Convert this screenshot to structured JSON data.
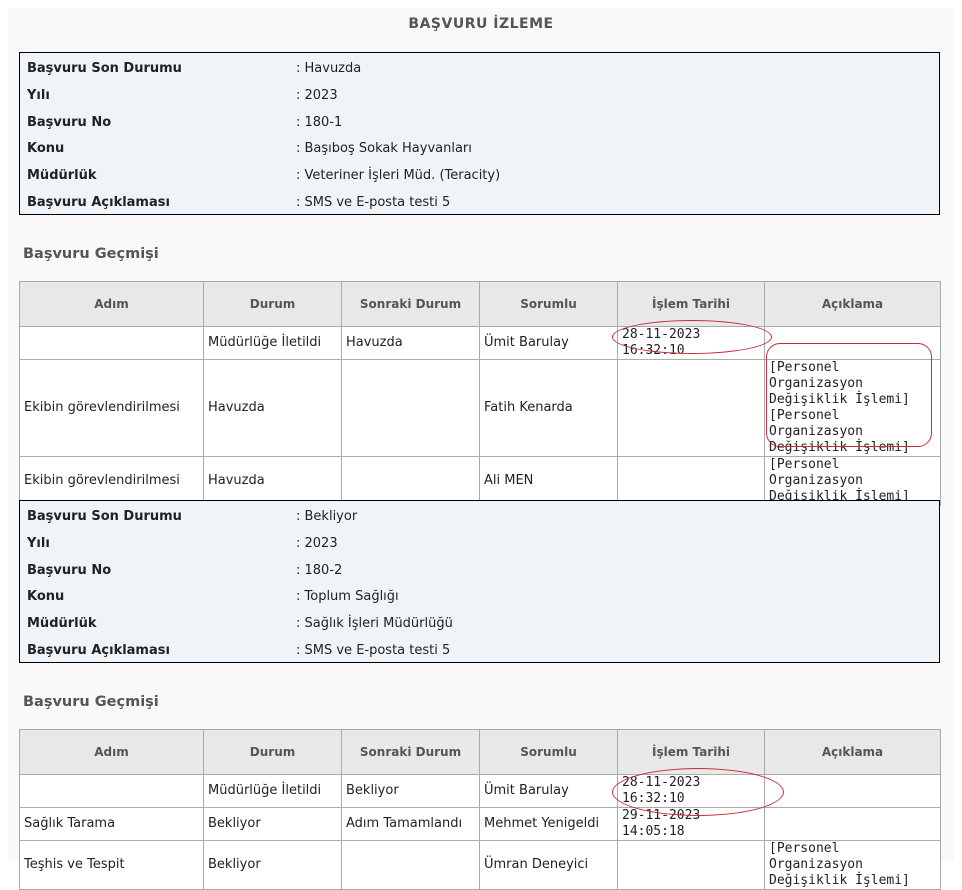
{
  "page_title": "BAŞVURU İZLEME",
  "history_heading": "Başvuru Geçmişi",
  "field_labels": {
    "status": "Başvuru Son Durumu",
    "year": "Yılı",
    "number": "Başvuru No",
    "subject": "Konu",
    "directorate": "Müdürlük",
    "description": "Başvuru Açıklaması"
  },
  "table_headers": [
    "Adım",
    "Durum",
    "Sonraki Durum",
    "Sorumlu",
    "İşlem Tarihi",
    "Açıklama"
  ],
  "applications": [
    {
      "status": ": Havuzda",
      "year": ": 2023",
      "number": ": 180-1",
      "subject": ": Başıboş Sokak Hayvanları",
      "directorate": ": Veteriner İşleri Müd. (Teracity)",
      "description": ": SMS ve E-posta testi 5",
      "rows": [
        {
          "step": "",
          "state": "Müdürlüğe İletildi",
          "next": "Havuzda",
          "owner": "Ümit Barulay",
          "date": "28-11-2023 16:32:10",
          "note": ""
        },
        {
          "step": "Ekibin görevlendirilmesi",
          "state": "Havuzda",
          "next": "",
          "owner": "Fatih Kenarda",
          "date": "",
          "note": "[Personel Organizasyon Değişiklik İşlemi] [Personel Organizasyon Değişiklik İşlemi]"
        },
        {
          "step": "Ekibin görevlendirilmesi",
          "state": "Havuzda",
          "next": "",
          "owner": "Ali MEN",
          "date": "",
          "note": "[Personel Organizasyon Değişiklik İşlemi]"
        }
      ]
    },
    {
      "status": ": Bekliyor",
      "year": ": 2023",
      "number": ": 180-2",
      "subject": ": Toplum Sağlığı",
      "directorate": ": Sağlık İşleri Müdürlüğü",
      "description": ": SMS ve E-posta testi 5",
      "rows": [
        {
          "step": "",
          "state": "Müdürlüğe İletildi",
          "next": "Bekliyor",
          "owner": "Ümit Barulay",
          "date": "28-11-2023 16:32:10",
          "note": ""
        },
        {
          "step": "Sağlık Tarama",
          "state": "Bekliyor",
          "next": "Adım Tamamlandı",
          "owner": "Mehmet Yenigeldi",
          "date": "29-11-2023 14:05:18",
          "note": ""
        },
        {
          "step": "Teşhis ve Tespit",
          "state": "Bekliyor",
          "next": "",
          "owner": "Ümran Deneyici",
          "date": "",
          "note": "[Personel Organizasyon Değişiklik İşlemi]"
        }
      ]
    }
  ],
  "colors": {
    "annotation": "#c0303a",
    "info_background": "#eef4f7",
    "header_background": "#e8e8e8"
  }
}
